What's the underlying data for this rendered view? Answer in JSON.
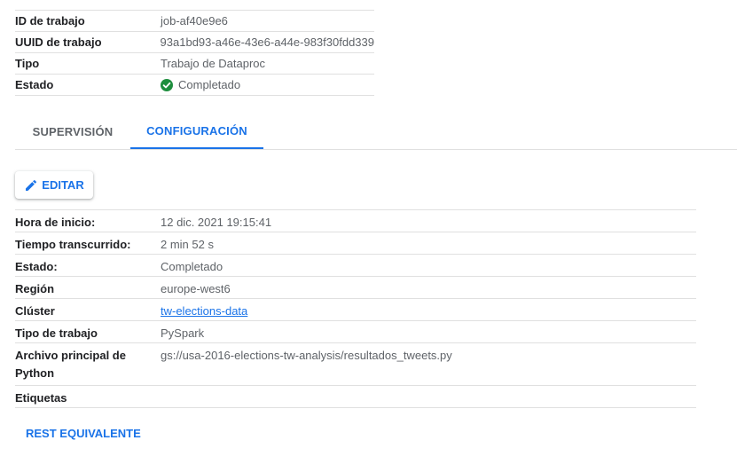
{
  "job_summary": {
    "rows": [
      {
        "key": "ID de trabajo",
        "value": "job-af40e9e6"
      },
      {
        "key": "UUID de trabajo",
        "value": "93a1bd93-a46e-43e6-a44e-983f30fdd339"
      },
      {
        "key": "Tipo",
        "value": "Trabajo de Dataproc"
      },
      {
        "key": "Estado",
        "value": "Completado",
        "icon": "check-circle-icon",
        "icon_color": "#1e8e3e"
      }
    ]
  },
  "tabs": [
    {
      "label": "SUPERVISIÓN",
      "active": false
    },
    {
      "label": "CONFIGURACIÓN",
      "active": true
    }
  ],
  "edit_button": {
    "label": "EDITAR",
    "icon": "pencil-icon"
  },
  "config": {
    "rows": [
      {
        "key": "Hora de inicio:",
        "value": "12 dic. 2021 19:15:41"
      },
      {
        "key": "Tiempo transcurrido:",
        "value": "2 min 52 s"
      },
      {
        "key": "Estado:",
        "value": "Completado"
      },
      {
        "key": "Región",
        "value": "europe-west6"
      },
      {
        "key": "Clúster",
        "value": "tw-elections-data",
        "link": true
      },
      {
        "key": "Tipo de trabajo",
        "value": "PySpark"
      },
      {
        "key": "Archivo principal de Python",
        "value": "gs://usa-2016-elections-tw-analysis/resultados_tweets.py"
      },
      {
        "key": "Etiquetas",
        "value": ""
      }
    ]
  },
  "rest_button": {
    "label": "REST EQUIVALENTE"
  },
  "colors": {
    "accent": "#1a73e8",
    "success": "#1e8e3e",
    "divider": "#e0e0e0",
    "secondary_text": "#5f6368"
  }
}
